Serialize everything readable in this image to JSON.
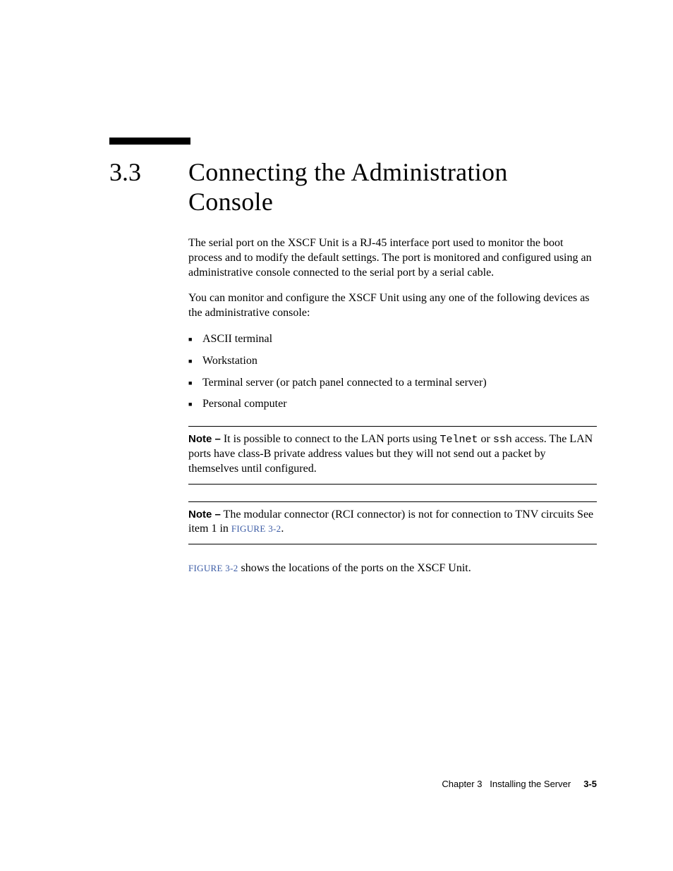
{
  "heading": {
    "number": "3.3",
    "title": "Connecting the Administration Console"
  },
  "body": {
    "p1": "The serial port on the XSCF Unit is a RJ-45 interface port used to monitor the boot process and to modify the default settings. The port is monitored and configured using an administrative console connected to the serial port by a serial cable.",
    "p2": "You can monitor and configure the XSCF Unit using any one of the following devices as the administrative console:",
    "bullets": [
      "ASCII terminal",
      "Workstation",
      "Terminal server (or patch panel connected to a terminal server)",
      "Personal computer"
    ],
    "note1": {
      "label": "Note –",
      "text_before_mono1": " It is possible to connect to the LAN ports using ",
      "mono1": "Telnet",
      "text_mid": " or ",
      "mono2": "ssh",
      "text_after": " access. The LAN ports have class-B private address values but they will not send out a packet by themselves until configured."
    },
    "note2": {
      "label": "Note –",
      "text_before": " The modular connector (RCI connector) is not for connection to TNV circuits See item 1 in ",
      "link": "FIGURE 3-2",
      "text_after": "."
    },
    "p3": {
      "link": "FIGURE 3-2",
      "text_after": "  shows the locations of the ports on the XSCF Unit."
    }
  },
  "footer": {
    "chapter": "Chapter 3",
    "title": "Installing the Server",
    "page": "3-5"
  }
}
